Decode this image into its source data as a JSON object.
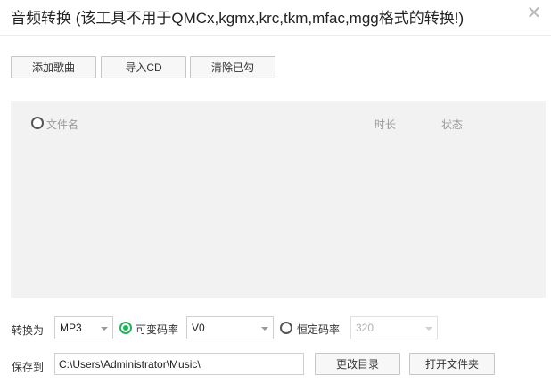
{
  "window": {
    "title": "音频转换 (该工具不用于QMCx,kgmx,krc,tkm,mfac,mgg格式的转换!)",
    "close_icon": "close-icon"
  },
  "toolbar": {
    "add_song_label": "添加歌曲",
    "import_cd_label": "导入CD",
    "clear_checked_label": "清除已勾"
  },
  "file_list": {
    "select_all_icon": "radio-icon",
    "columns": {
      "filename": "文件名",
      "duration": "时长",
      "status": "状态"
    },
    "rows": []
  },
  "convert": {
    "label": "转换为",
    "format": "MP3",
    "variable_bitrate_label": "可变码率",
    "variable_bitrate_selected": true,
    "variable_bitrate_value": "V0",
    "constant_bitrate_label": "恒定码率",
    "constant_bitrate_selected": false,
    "constant_bitrate_value": "320"
  },
  "save": {
    "label": "保存到",
    "path": "C:\\Users\\Administrator\\Music\\",
    "change_dir_label": "更改目录",
    "open_folder_label": "打开文件夹"
  },
  "colors": {
    "accent": "#21b45a",
    "list_bg": "#f2f2f2"
  }
}
